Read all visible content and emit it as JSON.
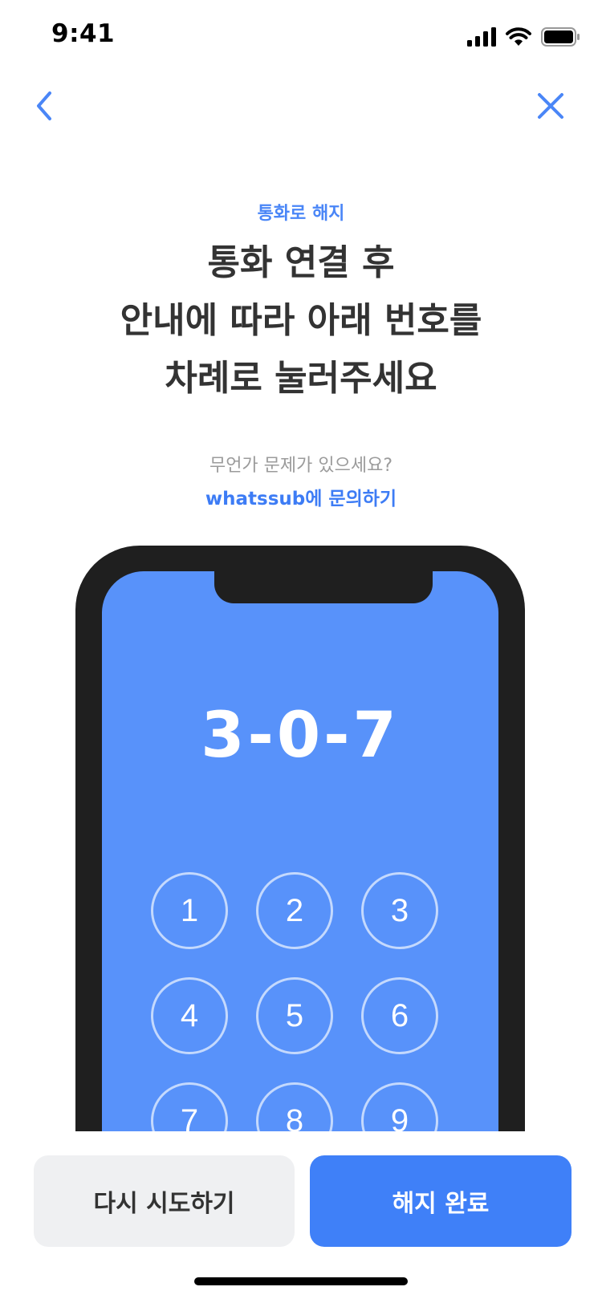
{
  "status_bar": {
    "time": "9:41",
    "icons": [
      "cellular-signal-icon",
      "wifi-icon",
      "battery-icon"
    ]
  },
  "nav": {
    "back_icon": "chevron-left-icon",
    "close_icon": "close-icon",
    "accent_color": "#4A86F7"
  },
  "content": {
    "eyebrow": "통화로 해지",
    "headline_lines": [
      "통화 연결 후",
      "안내에 따라 아래 번호를",
      "차례로 눌러주세요"
    ],
    "help_question": "무언가 문제가 있으세요?",
    "help_link": "whatssub에 문의하기"
  },
  "phone": {
    "code": "3-0-7",
    "keys": [
      "1",
      "2",
      "3",
      "4",
      "5",
      "6",
      "7",
      "8",
      "9"
    ],
    "screen_color": "#5892FA",
    "frame_color": "#1f1f1f"
  },
  "actions": {
    "retry_label": "다시 시도하기",
    "done_label": "해지 완료",
    "primary_color": "#3F80F8"
  }
}
